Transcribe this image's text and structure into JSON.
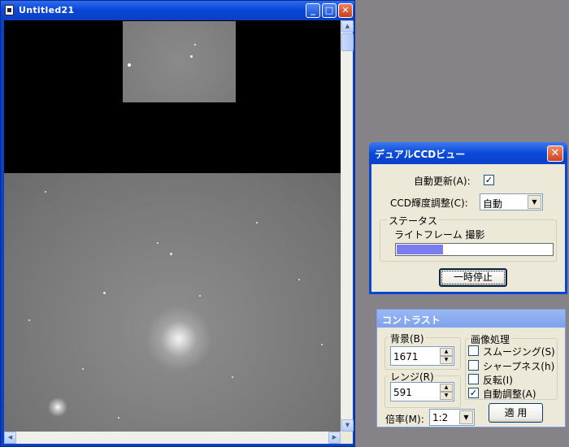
{
  "main_window": {
    "title": "Untitled21",
    "buttons": {
      "minimize": "_",
      "maximize": "□",
      "close": "✕"
    }
  },
  "ccd_dialog": {
    "title": "デュアルCCDビュー",
    "close": "✕",
    "auto_update_label": "自動更新(A):",
    "auto_update_checked": "✓",
    "brightness_label": "CCD輝度調整(C):",
    "brightness_value": "自動",
    "status_group": "ステータス",
    "status_text": "ライトフレーム 撮影",
    "progress": 0.3,
    "pause_button": "一時停止"
  },
  "contrast_dialog": {
    "title": "コントラスト",
    "background_label": "背景(B)",
    "background_value": "1671",
    "range_label": "レンジ(R)",
    "range_value": "591",
    "image_processing_label": "画像処理",
    "options": [
      {
        "label": "スムージング(S)",
        "checked": ""
      },
      {
        "label": "シャープネス(h)",
        "checked": ""
      },
      {
        "label": "反転(I)",
        "checked": ""
      },
      {
        "label": "自動調整(A)",
        "checked": "✓"
      }
    ],
    "zoom_label": "倍率(M):",
    "zoom_value": "1:2",
    "apply_button": "適 用"
  },
  "icons": {
    "dropdown": "▼",
    "spin_up": "▲",
    "spin_down": "▼",
    "scroll_up": "▲",
    "scroll_down": "▼",
    "scroll_left": "◀",
    "scroll_right": "▶"
  },
  "colors": {
    "xp_title_blue": "#0a48d8",
    "progress_fill": "#7b7cee",
    "desktop": "#858288"
  }
}
